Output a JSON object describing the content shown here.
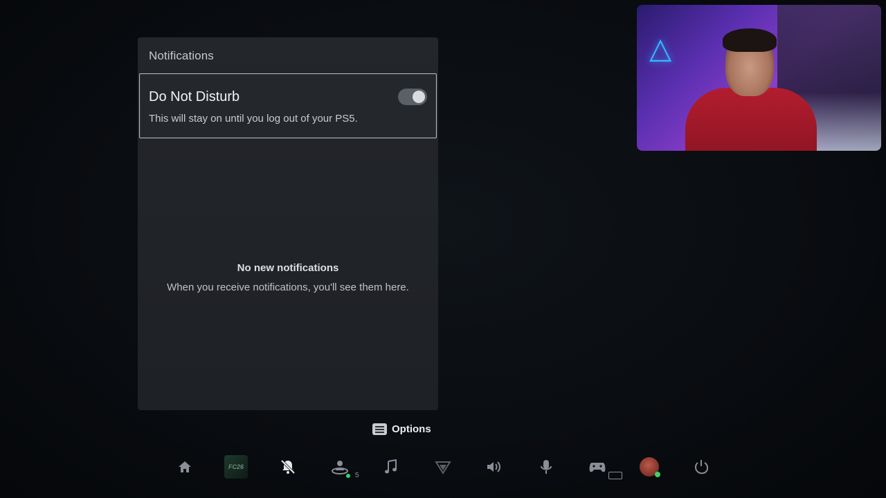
{
  "panel": {
    "title": "Notifications",
    "dnd": {
      "title": "Do Not Disturb",
      "description": "This will stay on until you log out of your PS5.",
      "enabled": true
    },
    "empty_state": {
      "title": "No new notifications",
      "message": "When you receive notifications, you'll see them here."
    }
  },
  "options": {
    "label": "Options"
  },
  "control_center": {
    "items": [
      {
        "icon": "home-icon"
      },
      {
        "icon": "game-tile-icon",
        "label": "FC26"
      },
      {
        "icon": "notifications-muted-icon",
        "active": true
      },
      {
        "icon": "game-base-icon",
        "badge": "5"
      },
      {
        "icon": "music-icon"
      },
      {
        "icon": "network-icon"
      },
      {
        "icon": "sound-icon"
      },
      {
        "icon": "mic-icon"
      },
      {
        "icon": "controller-icon"
      },
      {
        "icon": "avatar-icon"
      },
      {
        "icon": "power-icon"
      }
    ]
  },
  "colors": {
    "panel_bg": "#23262b",
    "toggle_track": "#5b5f66",
    "online_green": "#3ad36b"
  }
}
